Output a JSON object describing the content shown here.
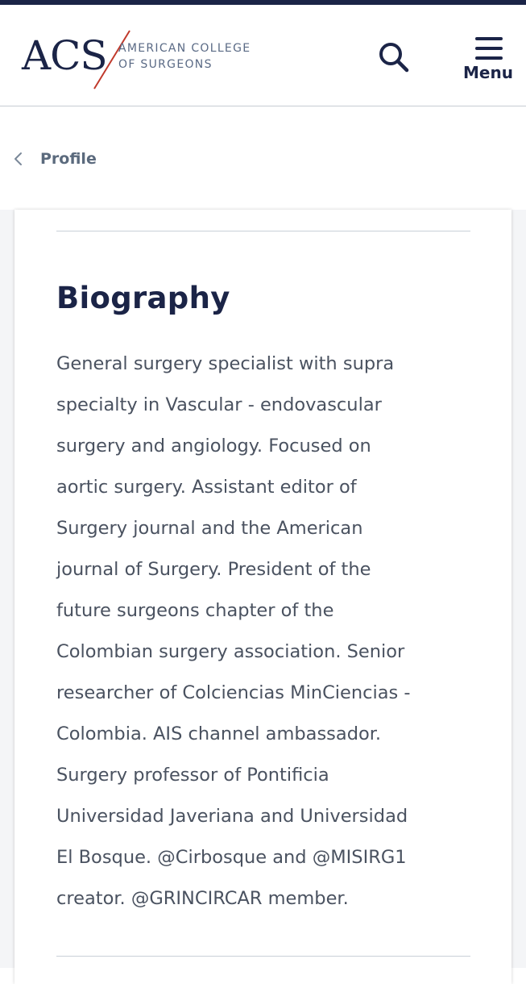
{
  "header": {
    "logo": {
      "mark": "ACS",
      "line1": "AMERICAN COLLEGE",
      "line2": "OF SURGEONS"
    },
    "search_icon": "search-icon",
    "menu_icon": "hamburger-icon",
    "menu_label": "Menu"
  },
  "breadcrumb": {
    "back_icon": "chevron-left-icon",
    "label": "Profile"
  },
  "biography": {
    "title": "Biography",
    "lines": [
      "General surgery specialist with supra",
      "specialty in Vascular - endovascular",
      "surgery and angiology. Focused on",
      "aortic surgery. Assistant editor of",
      "Surgery journal and the American",
      "journal of Surgery. President of the",
      "future surgeons chapter of the",
      "Colombian surgery association. Senior",
      "researcher of Colciencias MinCiencias -",
      "Colombia. AIS channel ambassador.",
      "Surgery professor of Pontificia",
      "Universidad Javeriana and Universidad",
      "El Bosque. @Cirbosque and @MISIRG1",
      "creator. @GRINCIRCAR member."
    ]
  },
  "colors": {
    "navy": "#1b2447",
    "logo_slash": "#c0392b",
    "body_text": "#4a5260",
    "breadcrumb_text": "#5b6a7d"
  }
}
